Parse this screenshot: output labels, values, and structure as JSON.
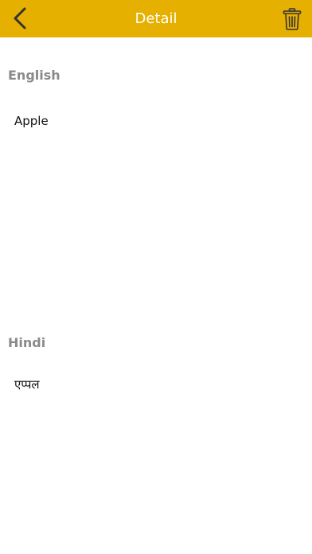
{
  "header": {
    "title": "Detail",
    "back_icon": "chevron-left-icon",
    "delete_icon": "trash-icon",
    "background_color": "#E6B000"
  },
  "translation": {
    "source": {
      "language": "English",
      "text": "Apple"
    },
    "target": {
      "language": "Hindi",
      "text": "एप्पल"
    }
  }
}
